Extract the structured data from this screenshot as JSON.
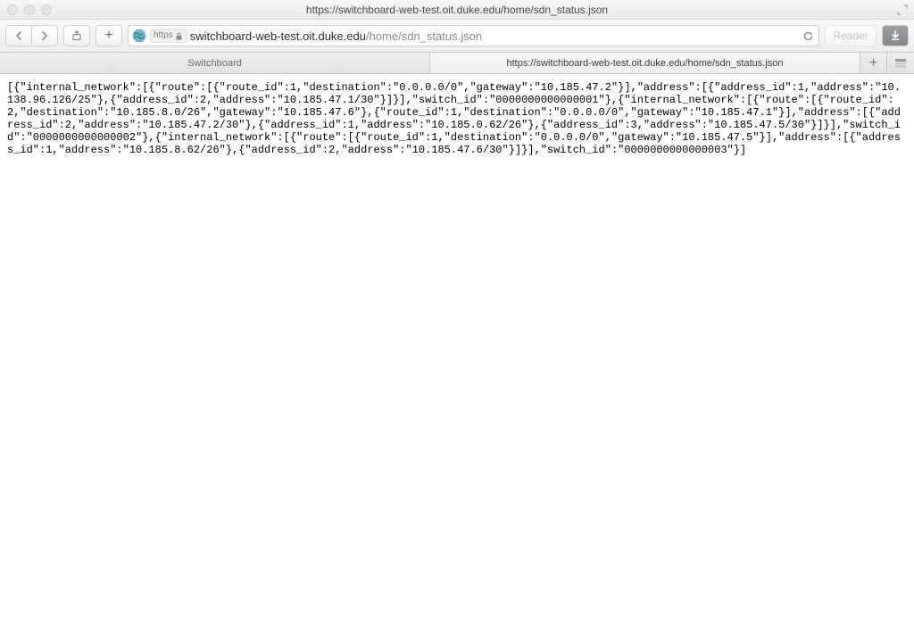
{
  "window": {
    "title": "https://switchboard-web-test.oit.duke.edu/home/sdn_status.json"
  },
  "toolbar": {
    "https_label": "https",
    "url_host": "switchboard-web-test.oit.duke.edu",
    "url_path": "/home/sdn_status.json",
    "reader_label": "Reader"
  },
  "tabs": {
    "tab1_label": "Switchboard",
    "tab2_label": "https://switchboard-web-test.oit.duke.edu/home/sdn_status.json",
    "add_label": "+"
  },
  "body_text": "[{\"internal_network\":[{\"route\":[{\"route_id\":1,\"destination\":\"0.0.0.0/0\",\"gateway\":\"10.185.47.2\"}],\"address\":[{\"address_id\":1,\"address\":\"10.138.96.126/25\"},{\"address_id\":2,\"address\":\"10.185.47.1/30\"}]}],\"switch_id\":\"0000000000000001\"},{\"internal_network\":[{\"route\":[{\"route_id\":2,\"destination\":\"10.185.8.0/26\",\"gateway\":\"10.185.47.6\"},{\"route_id\":1,\"destination\":\"0.0.0.0/0\",\"gateway\":\"10.185.47.1\"}],\"address\":[{\"address_id\":2,\"address\":\"10.185.47.2/30\"},{\"address_id\":1,\"address\":\"10.185.0.62/26\"},{\"address_id\":3,\"address\":\"10.185.47.5/30\"}]}],\"switch_id\":\"0000000000000002\"},{\"internal_network\":[{\"route\":[{\"route_id\":1,\"destination\":\"0.0.0.0/0\",\"gateway\":\"10.185.47.5\"}],\"address\":[{\"address_id\":1,\"address\":\"10.185.8.62/26\"},{\"address_id\":2,\"address\":\"10.185.47.6/30\"}]}],\"switch_id\":\"0000000000000003\"}]"
}
